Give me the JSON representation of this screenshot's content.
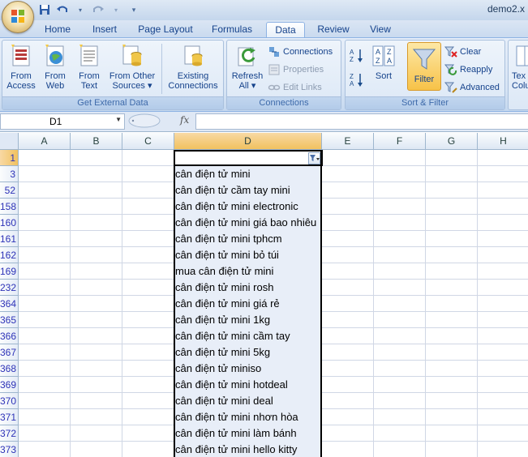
{
  "window": {
    "title": "demo2.x"
  },
  "quick_access": {
    "icons": [
      "save-icon",
      "undo-icon",
      "redo-icon",
      "customize-icon"
    ]
  },
  "tabs": [
    {
      "label": "Home"
    },
    {
      "label": "Insert"
    },
    {
      "label": "Page Layout"
    },
    {
      "label": "Formulas"
    },
    {
      "label": "Data",
      "active": true
    },
    {
      "label": "Review"
    },
    {
      "label": "View"
    }
  ],
  "ribbon": {
    "get_external": {
      "label": "Get External Data",
      "from_access": "From\nAccess",
      "from_web": "From\nWeb",
      "from_text": "From\nText",
      "from_other": "From Other\nSources ▾",
      "existing": "Existing\nConnections"
    },
    "connections": {
      "label": "Connections",
      "refresh": "Refresh\nAll ▾",
      "connections": "Connections",
      "properties": "Properties",
      "edit_links": "Edit Links"
    },
    "sort_filter": {
      "label": "Sort & Filter",
      "sort": "Sort",
      "filter": "Filter",
      "clear": "Clear",
      "reapply": "Reapply",
      "advanced": "Advanced"
    },
    "partial": {
      "text_to_columns": "Tex\nColu"
    }
  },
  "formula_bar": {
    "name_box": "D1",
    "fx": "fx",
    "formula": ""
  },
  "columns": [
    "A",
    "B",
    "C",
    "D",
    "E",
    "F",
    "G",
    "H"
  ],
  "selected_column": "D",
  "rows": [
    {
      "num": "1",
      "d": ""
    },
    {
      "num": "3",
      "d": "cân điện tử mini"
    },
    {
      "num": "52",
      "d": "cân điện tử cầm tay mini"
    },
    {
      "num": "158",
      "d": "cân điện tử mini electronic"
    },
    {
      "num": "160",
      "d": "cân điện tử mini giá bao nhiêu"
    },
    {
      "num": "161",
      "d": "cân điện tử mini tphcm"
    },
    {
      "num": "162",
      "d": "cân điện tử mini bỏ túi"
    },
    {
      "num": "169",
      "d": "mua cân điện tử mini"
    },
    {
      "num": "232",
      "d": "cân điện tử mini rosh"
    },
    {
      "num": "364",
      "d": "cân điện tử mini giá rẻ"
    },
    {
      "num": "365",
      "d": "cân điện tử mini 1kg"
    },
    {
      "num": "366",
      "d": "cân điện tử mini cầm tay"
    },
    {
      "num": "367",
      "d": "cân điện tử mini 5kg"
    },
    {
      "num": "368",
      "d": "cân điện tử miniso"
    },
    {
      "num": "369",
      "d": "cân điện tử mini hotdeal"
    },
    {
      "num": "370",
      "d": "cân điện tử mini deal"
    },
    {
      "num": "371",
      "d": "cân điện tử mini nhơn hòa"
    },
    {
      "num": "372",
      "d": "cân điện tử mini làm bánh"
    },
    {
      "num": "373",
      "d": "cân điện tử mini hello kitty"
    }
  ]
}
